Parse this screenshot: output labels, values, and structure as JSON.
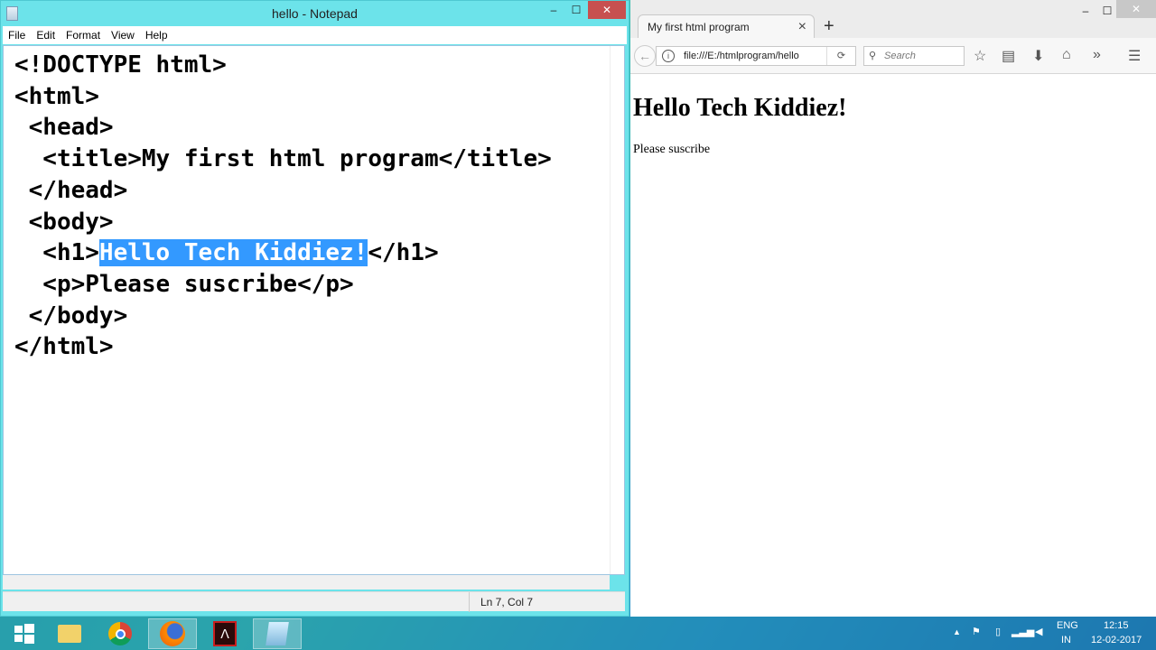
{
  "notepad": {
    "title": "hello - Notepad",
    "menu": [
      "File",
      "Edit",
      "Format",
      "View",
      "Help"
    ],
    "lines": [
      {
        "text": "<!DOCTYPE html>"
      },
      {
        "text": "<html>"
      },
      {
        "text": " <head>"
      },
      {
        "text": "  <title>My first html program</title>"
      },
      {
        "text": " </head>"
      },
      {
        "text": " <body>"
      },
      {
        "pre": "  <h1>",
        "sel": "Hello Tech Kiddiez!",
        "post": "</h1>"
      },
      {
        "text": "  <p>Please suscribe</p>"
      },
      {
        "text": " </body>"
      },
      {
        "text": "</html>"
      }
    ],
    "status": "Ln 7, Col 7"
  },
  "firefox": {
    "tab_title": "My first html program",
    "url": "file:///E:/htmlprogram/hello",
    "search_placeholder": "Search",
    "page": {
      "h1": "Hello Tech Kiddiez!",
      "p": "Please suscribe"
    }
  },
  "window_buttons": {
    "min": "–",
    "max": "☐",
    "close": "✕"
  },
  "taskbar": {
    "items": [
      "start",
      "file-explorer",
      "chrome",
      "firefox",
      "acrobat",
      "notepad"
    ],
    "lang": "ENG",
    "region": "IN",
    "time": "12:15",
    "date": "12-02-2017"
  }
}
